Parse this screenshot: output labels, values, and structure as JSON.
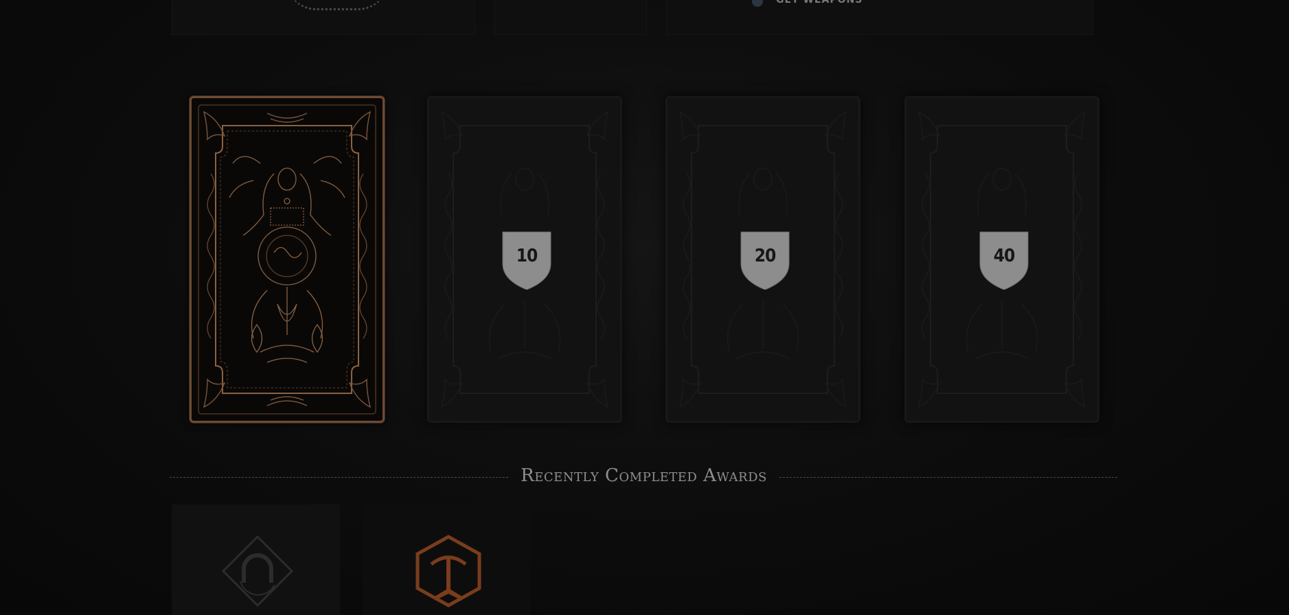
{
  "top_bar": {
    "label": "Get Weapons"
  },
  "cards": [
    {
      "id": "card-1",
      "state": "unlocked",
      "badge": null
    },
    {
      "id": "card-2",
      "state": "locked",
      "badge": "10"
    },
    {
      "id": "card-3",
      "state": "locked",
      "badge": "20"
    },
    {
      "id": "card-4",
      "state": "locked",
      "badge": "40"
    }
  ],
  "recent_awards": {
    "title": "Recently Completed Awards",
    "items": [
      {
        "icon": "horseshoe-icon",
        "state": "inactive"
      },
      {
        "icon": "pickaxe-book-icon",
        "state": "completed"
      }
    ]
  },
  "colors": {
    "background": "#0b0b0b",
    "card_border_active": "#6e4b33",
    "card_ornament_active": "#8a6242",
    "badge_fill": "#8d8d8d",
    "award_accent": "#7a3d1c",
    "title_text": "#8e8e8e"
  }
}
